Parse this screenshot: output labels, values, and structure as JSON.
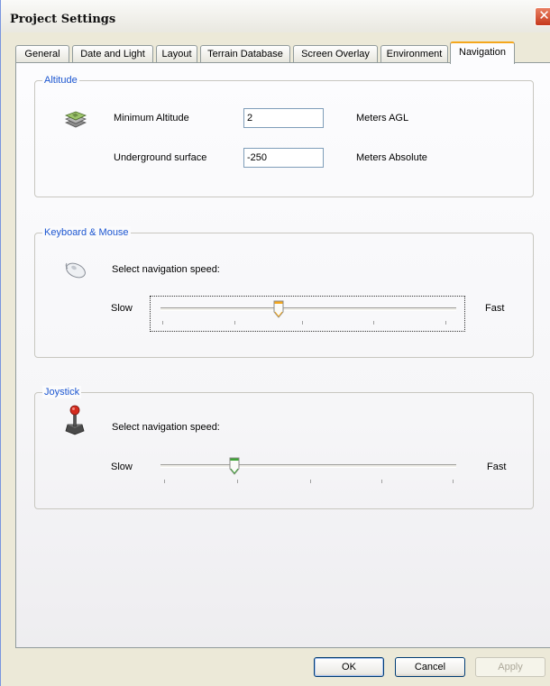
{
  "window": {
    "title": "Project Settings",
    "close_glyph": "✕"
  },
  "tabs": [
    {
      "label": "General"
    },
    {
      "label": "Date and Light"
    },
    {
      "label": "Layout"
    },
    {
      "label": "Terrain Database"
    },
    {
      "label": "Screen Overlay"
    },
    {
      "label": "Environment"
    },
    {
      "label": "Navigation",
      "active": true
    }
  ],
  "altitude": {
    "title": "Altitude",
    "icon": "terrain-layers-icon",
    "min_label": "Minimum Altitude",
    "min_value": "2",
    "min_unit": "Meters AGL",
    "under_label": "Underground surface",
    "under_value": "-250",
    "under_unit": "Meters Absolute"
  },
  "keyboard_mouse": {
    "title": "Keyboard & Mouse",
    "icon": "mouse-icon",
    "prompt": "Select navigation speed:",
    "slow_label": "Slow",
    "fast_label": "Fast",
    "speed_fraction": 0.4,
    "thumb_color": "#f4a71d"
  },
  "joystick": {
    "title": "Joystick",
    "icon": "joystick-icon",
    "prompt": "Select navigation speed:",
    "slow_label": "Slow",
    "fast_label": "Fast",
    "speed_fraction": 0.25,
    "thumb_color": "#3ea437"
  },
  "buttons": {
    "ok": "OK",
    "cancel": "Cancel",
    "apply": "Apply"
  },
  "colors": {
    "accent": "#1c56d1",
    "tab_highlight": "#f4a71d"
  }
}
